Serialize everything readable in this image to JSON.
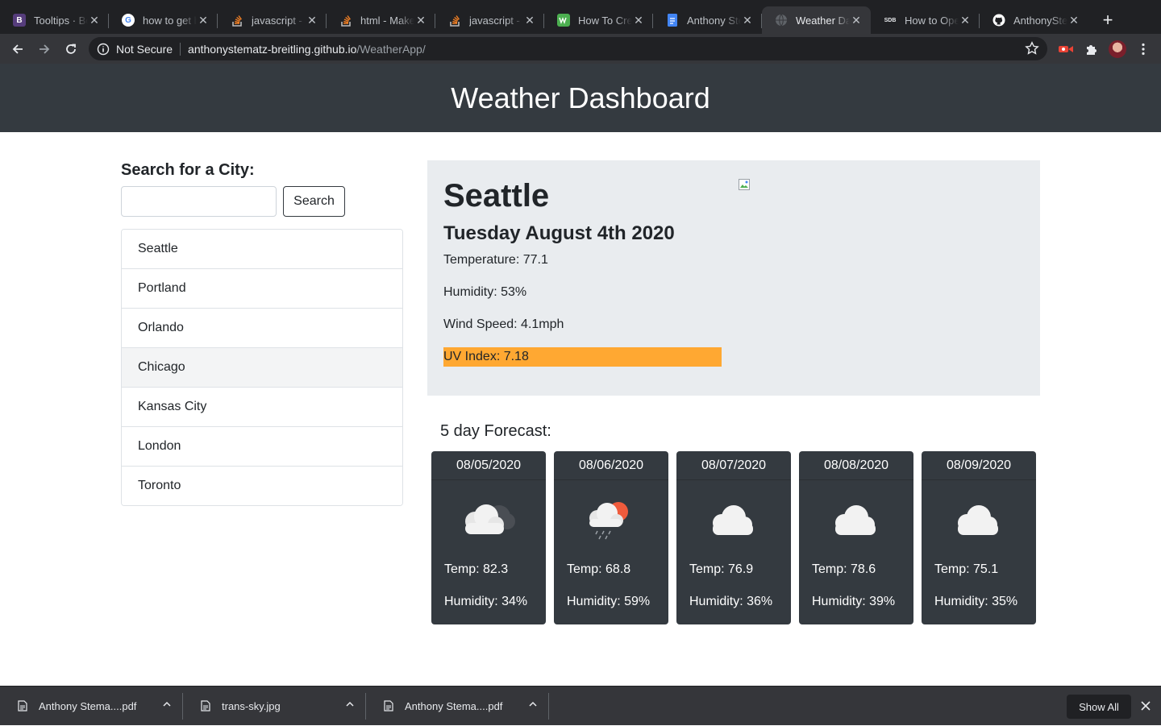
{
  "browser": {
    "tabs": [
      {
        "title": "Tooltips · Bootstrap",
        "favicon_letter": "B",
        "favicon_color": "#563d7c",
        "favicon_icon": "bootstrap-icon"
      },
      {
        "title": "how to get bootstrap",
        "favicon_letter": "G",
        "favicon_color": "#ffffff",
        "favicon_icon": "google-icon"
      },
      {
        "title": "javascript - How to",
        "favicon_letter": "",
        "favicon_color": "#f48024",
        "favicon_icon": "stackoverflow-icon"
      },
      {
        "title": "html - Make",
        "favicon_letter": "",
        "favicon_color": "#f48024",
        "favicon_icon": "stackoverflow-icon"
      },
      {
        "title": "javascript - How",
        "favicon_letter": "",
        "favicon_color": "#f48024",
        "favicon_icon": "stackoverflow-icon"
      },
      {
        "title": "How To Create",
        "favicon_letter": "",
        "favicon_color": "#4caf50",
        "favicon_icon": "w3schools-icon"
      },
      {
        "title": "Anthony Stematz",
        "favicon_letter": "",
        "favicon_color": "#4285f4",
        "favicon_icon": "google-docs-icon"
      },
      {
        "title": "Weather Dashboard",
        "favicon_letter": "",
        "favicon_color": "#5f6368",
        "favicon_icon": "globe-icon",
        "active": true
      },
      {
        "title": "How to Open",
        "favicon_letter": "SDB",
        "favicon_color": "#35363a",
        "favicon_icon": "sdb-icon"
      },
      {
        "title": "AnthonyStematz",
        "favicon_letter": "",
        "favicon_color": "#ffffff",
        "favicon_icon": "github-icon"
      }
    ],
    "security_label": "Not Secure",
    "url_host": "anthonystematz-breitling.github.io",
    "url_path": "/WeatherApp/"
  },
  "header": {
    "title": "Weather Dashboard"
  },
  "search": {
    "label": "Search for a City:",
    "placeholder": "",
    "value": "",
    "button_label": "Search"
  },
  "cities": [
    "Seattle",
    "Portland",
    "Orlando",
    "Chicago",
    "Kansas City",
    "London",
    "Toronto"
  ],
  "current": {
    "city": "Seattle",
    "date": "Tuesday August 4th 2020",
    "temperature": "Temperature: 77.1",
    "humidity": "Humidity: 53%",
    "wind": "Wind Speed: 4.1mph",
    "uv": "UV Index: 7.18",
    "uv_color": "#ffa832"
  },
  "forecast": {
    "title": "5 day Forecast:",
    "days": [
      {
        "date": "08/05/2020",
        "icon": "cloudy-dark-icon",
        "temp": "Temp: 82.3",
        "humidity": "Humidity: 34%"
      },
      {
        "date": "08/06/2020",
        "icon": "rain-sun-icon",
        "temp": "Temp: 68.8",
        "humidity": "Humidity: 59%"
      },
      {
        "date": "08/07/2020",
        "icon": "cloud-icon",
        "temp": "Temp: 76.9",
        "humidity": "Humidity: 36%"
      },
      {
        "date": "08/08/2020",
        "icon": "cloud-icon",
        "temp": "Temp: 78.6",
        "humidity": "Humidity: 39%"
      },
      {
        "date": "08/09/2020",
        "icon": "cloud-icon",
        "temp": "Temp: 75.1",
        "humidity": "Humidity: 35%"
      }
    ]
  },
  "downloads": {
    "items": [
      "Anthony Stema....pdf",
      "trans-sky.jpg",
      "Anthony Stema....pdf"
    ],
    "show_all_label": "Show All"
  },
  "colors": {
    "header_bg": "#343a40",
    "card_bg": "#e9ecef",
    "forecast_bg": "#343a40",
    "uv_warning": "#ffa832"
  }
}
